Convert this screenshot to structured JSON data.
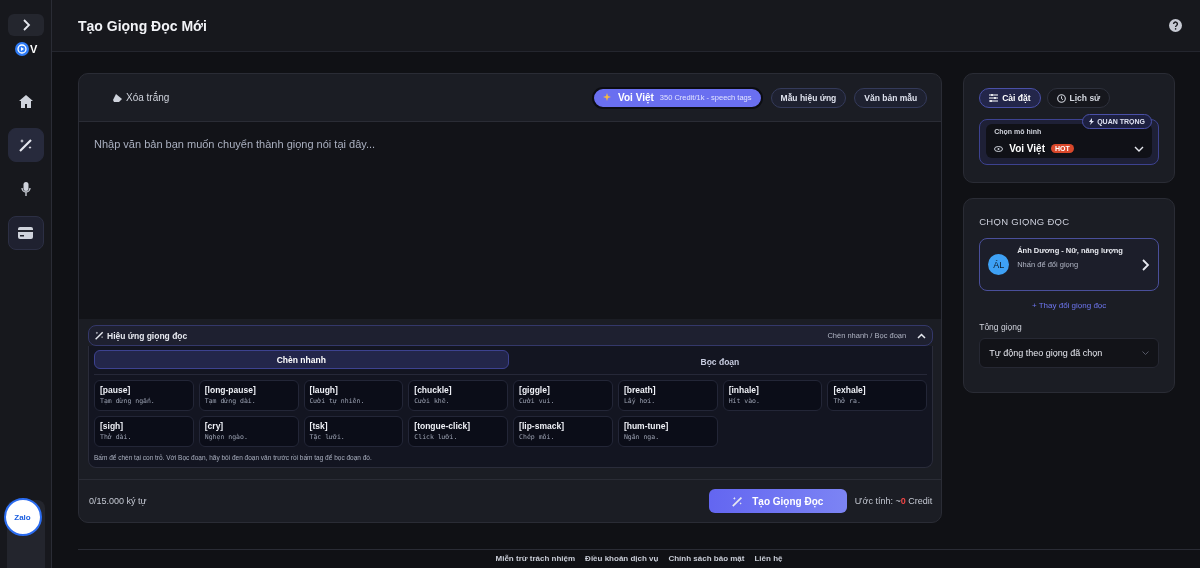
{
  "sidebar": {
    "logo_text": "V",
    "items": [
      {
        "kind": "home",
        "selected": false
      },
      {
        "kind": "magic",
        "selected": true
      },
      {
        "kind": "mic",
        "selected": false
      },
      {
        "kind": "card",
        "selected": false
      }
    ],
    "chat_label": "Zalo"
  },
  "header": {
    "title": "Tạo Giọng Đọc Mới"
  },
  "editor": {
    "clear_button": "Xóa trắng",
    "model_chip": {
      "name": "Voi Việt",
      "price": "350 Credit/1k - speech tags"
    },
    "buttons": [
      "Mẫu hiệu ứng",
      "Văn bản mẫu"
    ],
    "textarea": {
      "placeholder": "Nhập văn bản bạn muốn chuyển thành giọng nói tại đây..."
    },
    "effects": {
      "title": "Hiệu ứng giọng đọc",
      "hint": "Chèn nhanh / Bọc đoạn",
      "expanded": true,
      "tabs": [
        {
          "label": "Chèn nhanh",
          "selected": true
        },
        {
          "label": "Bọc đoạn",
          "selected": false
        }
      ],
      "tags": [
        {
          "tag": "[pause]",
          "desc": "Tạm dừng ngắn."
        },
        {
          "tag": "[long-pause]",
          "desc": "Tạm dừng dài."
        },
        {
          "tag": "[laugh]",
          "desc": "Cười tự nhiên."
        },
        {
          "tag": "[chuckle]",
          "desc": "Cười khẽ."
        },
        {
          "tag": "[giggle]",
          "desc": "Cười vui."
        },
        {
          "tag": "[breath]",
          "desc": "Lấy hơi."
        },
        {
          "tag": "[inhale]",
          "desc": "Hít vào."
        },
        {
          "tag": "[exhale]",
          "desc": "Thở ra."
        },
        {
          "tag": "[sigh]",
          "desc": "Thở dài."
        },
        {
          "tag": "[cry]",
          "desc": "Nghẹn ngào."
        },
        {
          "tag": "[tsk]",
          "desc": "Tặc lưỡi."
        },
        {
          "tag": "[tongue-click]",
          "desc": "Click lưỡi."
        },
        {
          "tag": "[lip-smack]",
          "desc": "Chép môi."
        },
        {
          "tag": "[hum-tune]",
          "desc": "Ngân nga."
        }
      ],
      "note": "Bấm để chèn tại con trỏ. Với Bọc đoạn, hãy bôi đen đoạn văn trước rồi bấm tag để bọc đoạn đó."
    },
    "char_count": "0/15.000 ký tự",
    "generate_button": "Tạo Giọng Đọc",
    "estimate": "Ước tính: ~**0** Credit"
  },
  "settings": {
    "tabs": [
      {
        "label": "Cài đặt",
        "selected": true
      },
      {
        "label": "Lịch sử",
        "selected": false
      }
    ],
    "model_select": {
      "label": "Chọn mô hình",
      "value": "Voi Việt",
      "badge": "HOT",
      "important": "QUAN TRỌNG"
    }
  },
  "voice": {
    "heading": "CHỌN GIỌNG ĐỌC",
    "initials": "ÁL",
    "name": "Ánh Dương - Nữ, năng lượng",
    "hint": "Nhấn để đổi giọng",
    "change_link": "+ Thay đổi giọng đọc",
    "tone_label": "Tông giọng",
    "tone_value": "Tự động theo giọng đã chọn"
  },
  "footer": {
    "links": [
      "Miễn trừ trách nhiệm",
      "Điều khoản dịch vụ",
      "Chính sách bảo mật",
      "Liên hệ"
    ]
  }
}
